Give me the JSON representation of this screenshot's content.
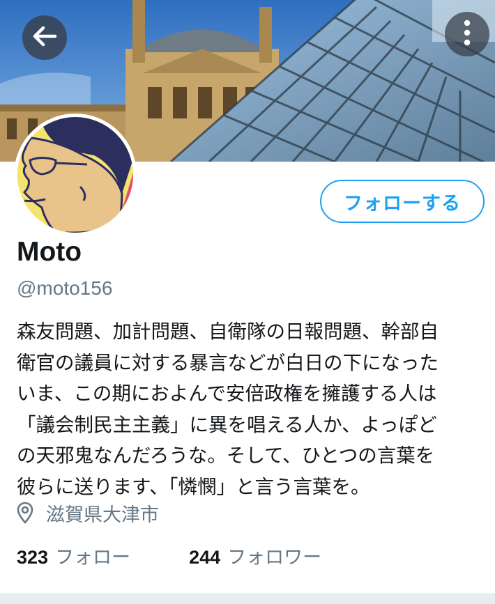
{
  "header": {
    "back_icon": "arrow-left-icon",
    "more_icon": "more-vertical-icon",
    "banner": "louvre-pyramid-photo"
  },
  "profile": {
    "avatar": "cartoon-face-with-glasses",
    "follow_label": "フォローする",
    "name": "Moto",
    "handle": "@moto156",
    "bio": "森友問題、加計問題、自衛隊の日報問題、幹部自\n衛官の議員に対する暴言などが白日の下になった\nいま、この期におよんで安倍政権を擁護する人は\n「議会制民主主義」に異を唱える人か、よっぽど\nの天邪鬼なんだろうな。そして、ひとつの言葉を\n彼らに送ります、「憐憫」と言う言葉を。",
    "location": "滋賀県大津市",
    "location_icon": "location-pin-icon"
  },
  "stats": {
    "following_count": "323",
    "following_label": "フォロー",
    "followers_count": "244",
    "followers_label": "フォロワー"
  },
  "colors": {
    "accent": "#1da1f2",
    "secondary_text": "#657786",
    "primary_text": "#14171a"
  }
}
